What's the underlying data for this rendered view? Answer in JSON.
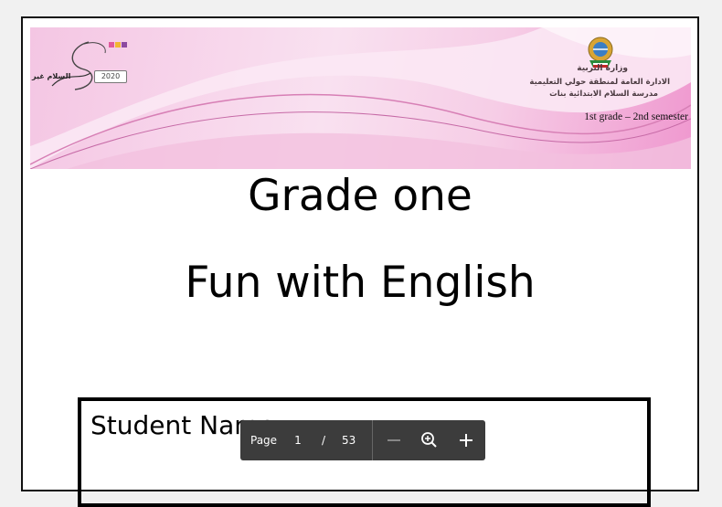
{
  "document": {
    "header": {
      "ministry_line": "وزارة التربية",
      "district_line": "الادارة العامة لمنطقة حولي التعليمية",
      "school_line": "مدرسة السلام الابتدائية بنات",
      "grade_semester": "1st grade – 2nd semester",
      "left_logo_text": "السلام غير",
      "left_logo_year": "2020"
    },
    "title_line1": "Grade one",
    "title_line2": "Fun with English",
    "student_name_label": "Student Name:"
  },
  "pdf_toolbar": {
    "page_label": "Page",
    "current_page": "1",
    "separator": "/",
    "total_pages": "53",
    "zoom_out_icon": "minus-icon",
    "zoom_icon": "magnifier-plus-icon",
    "zoom_in_icon": "plus-icon"
  },
  "colors": {
    "banner_pink": "#f4c6e3",
    "banner_magenta": "#ef98cf",
    "toolbar_bg": "#3c3c3c"
  }
}
